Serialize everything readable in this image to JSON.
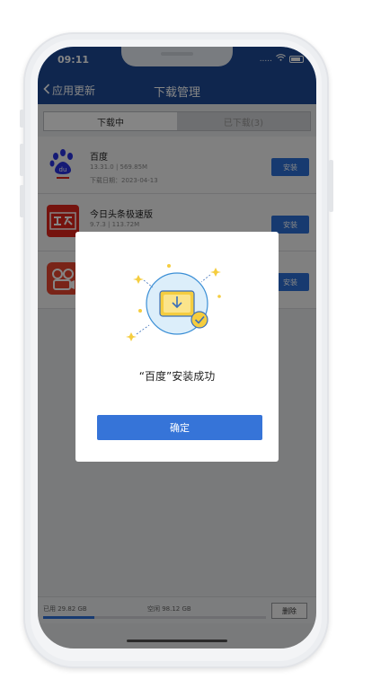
{
  "status_bar": {
    "time": "09:11",
    "signal_text": "....."
  },
  "nav": {
    "back_label": "应用更新",
    "title": "下载管理"
  },
  "tabs": [
    {
      "label": "下载中",
      "active": true
    },
    {
      "label": "已下载(3)",
      "active": false
    }
  ],
  "apps": [
    {
      "name": "百度",
      "meta": "13.31.0 | 569.85M",
      "date": "下载日期：2023-04-13",
      "install_label": "安装",
      "icon": "baidu-logo"
    },
    {
      "name": "今日头条极速版",
      "meta": "9.7.3 | 113.72M",
      "date": "",
      "install_label": "安装",
      "icon": "toutiao-logo"
    },
    {
      "name": "",
      "meta": "",
      "date": "",
      "install_label": "安装",
      "icon": "video-app-logo"
    }
  ],
  "storage": {
    "used": "已用 29.82 GB",
    "free": "空闲 98.12 GB",
    "used_fraction": 0.23
  },
  "bottom": {
    "delete_label": "删除"
  },
  "dialog": {
    "message": "“百度”安装成功",
    "confirm_label": "确定"
  },
  "colors": {
    "header": "#1d4a96",
    "accent": "#2d6fd6",
    "button": "#3674d8",
    "baidu_blue": "#2932e1",
    "toutiao_red": "#e1251b",
    "video_red": "#e8452f"
  }
}
